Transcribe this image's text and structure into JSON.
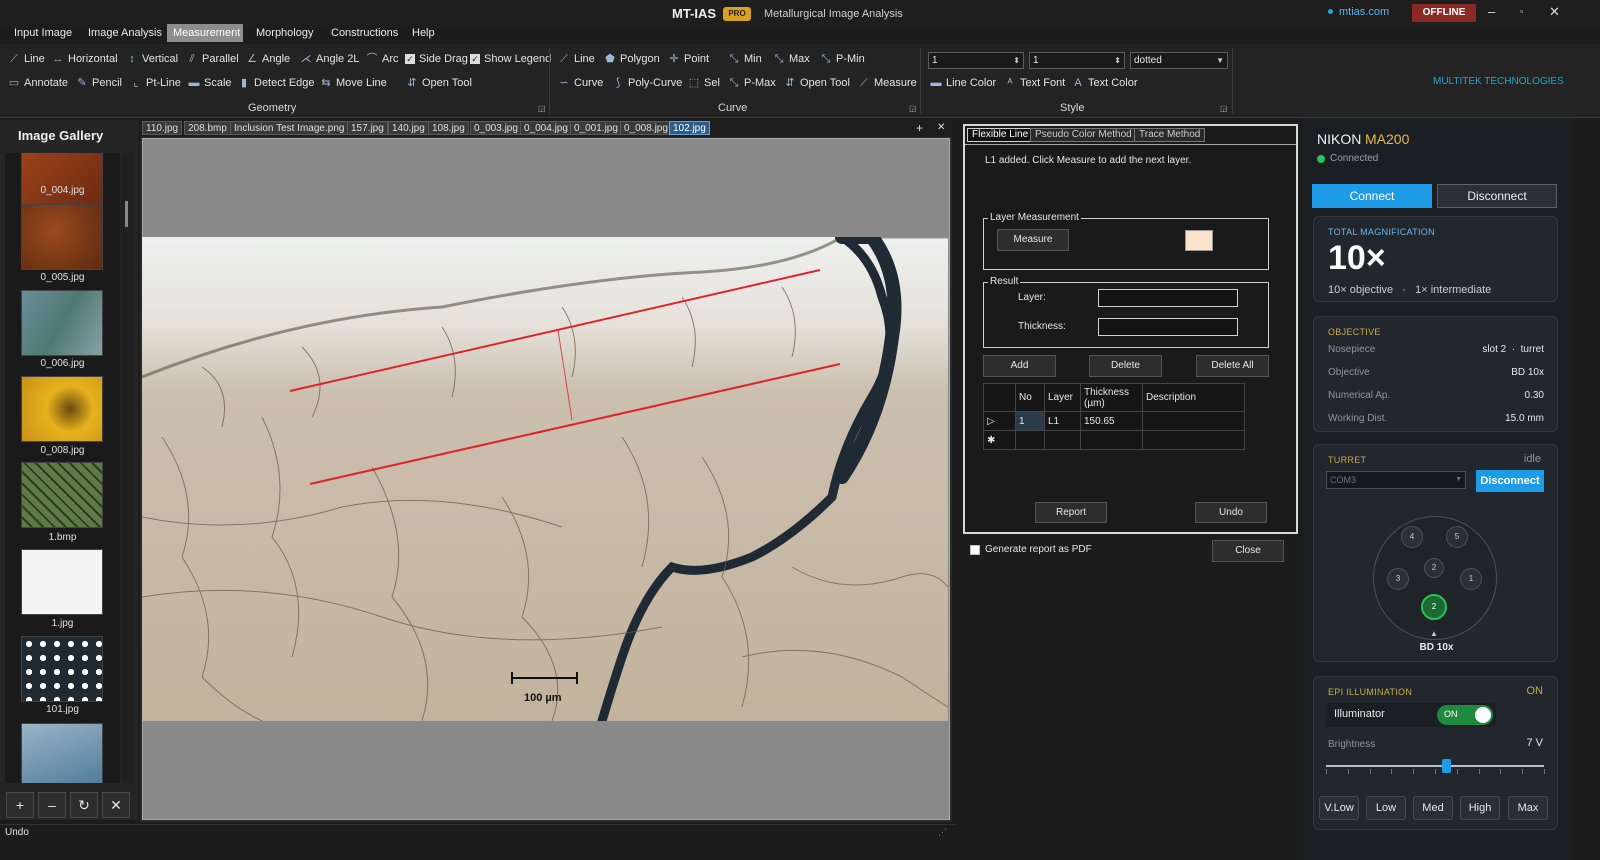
{
  "app": {
    "title": "MT-IAS",
    "badge": "PRO",
    "subtitle": "Metallurgical Image Analysis",
    "website": "mtias.com",
    "status": "OFFLINE",
    "brand": "MULTITEK TECHNOLOGIES"
  },
  "menu": [
    "Input Image",
    "Image Analysis",
    "Measurement",
    "Morphology",
    "Constructions",
    "Help"
  ],
  "geometry": {
    "row1": [
      "Line",
      "Horizontal",
      "Vertical",
      "Parallel",
      "Angle",
      "Angle 2L",
      "Arc",
      "Side Drag",
      "Show Legend"
    ],
    "row2": [
      "Annotate",
      "Pencil",
      "Pt-Line",
      "Scale",
      "Detect Edge",
      "Move Line",
      "Open Tool"
    ],
    "label": "Geometry"
  },
  "curve": {
    "row1": [
      "Line",
      "Polygon",
      "Point",
      "Min",
      "Max",
      "P-Min"
    ],
    "row2": [
      "Curve",
      "Poly-Curve",
      "Sel",
      "P-Max",
      "Open Tool",
      "Measure"
    ],
    "label": "Curve"
  },
  "style": {
    "combo1": "1",
    "combo2": "1",
    "combo3": "dotted",
    "items": [
      "Line Color",
      "Text Font",
      "Text Color"
    ],
    "label": "Style"
  },
  "gallery": {
    "title": "Image Gallery",
    "items": [
      "0_004.jpg",
      "0_005.jpg",
      "0_006.jpg",
      "0_008.jpg",
      "1.bmp",
      "1.jpg",
      "101.jpg"
    ]
  },
  "image_tabs": [
    "110.jpg",
    "208.bmp",
    "Inclusion Test Image.png",
    "157.jpg",
    "140.jpg",
    "108.jpg",
    "0_003.jpg",
    "0_004.jpg",
    "0_001.jpg",
    "0_008.jpg",
    "102.jpg"
  ],
  "scale_bar": "100 µm",
  "panel": {
    "tabs": [
      "Flexible Line",
      "Pseudo Color Method",
      "Trace Method"
    ],
    "message": "L1 added. Click Measure to add the next layer.",
    "layer_measurement": "Layer Measurement",
    "measure": "Measure",
    "result": "Result",
    "layer_label": "Layer:",
    "thickness_label": "Thickness:",
    "add": "Add",
    "delete": "Delete",
    "delete_all": "Delete All",
    "table_headers": [
      "No",
      "Layer",
      "Thickness (µm)",
      "Description"
    ],
    "rows": [
      {
        "no": "1",
        "layer": "L1",
        "thickness": "150.65",
        "description": ""
      }
    ],
    "report": "Report",
    "undo": "Undo",
    "pdf_label": "Generate report as PDF",
    "close": "Close"
  },
  "microscope": {
    "brand": "NIKON",
    "model": "MA200",
    "status": "Connected",
    "connect": "Connect",
    "disconnect": "Disconnect",
    "total_mag_label": "TOTAL MAGNIFICATION",
    "total_mag": "10×",
    "mag_detail": "10× objective   ·   1× intermediate",
    "objective_label": "OBJECTIVE",
    "nosepiece_label": "Nosepiece",
    "nosepiece": "slot 2  ·  turret",
    "objective_key": "Objective",
    "objective": "BD 10x",
    "na_label": "Numerical Ap.",
    "na": "0.30",
    "wd_label": "Working Dist.",
    "wd": "15.0 mm",
    "turret_label": "TURRET",
    "turret_state": "idle",
    "com_port": "COM3",
    "turret_btn": "Disconnect",
    "slots": [
      "4",
      "5",
      "3",
      "2",
      "1",
      "2"
    ],
    "selected": "BD 10x",
    "epi_label": "EPI ILLUMINATION",
    "epi_state": "ON",
    "illuminator": "Illuminator",
    "toggle": "ON",
    "brightness_label": "Brightness",
    "brightness": "7 V",
    "brightness_level": 0.55,
    "presets": [
      "V.Low",
      "Low",
      "Med",
      "High",
      "Max"
    ]
  },
  "status_text": "Undo",
  "colors": {
    "accent": "#1e9be6",
    "measure_line": "#e0232b",
    "brand_cyan": "#2aa5c9"
  }
}
